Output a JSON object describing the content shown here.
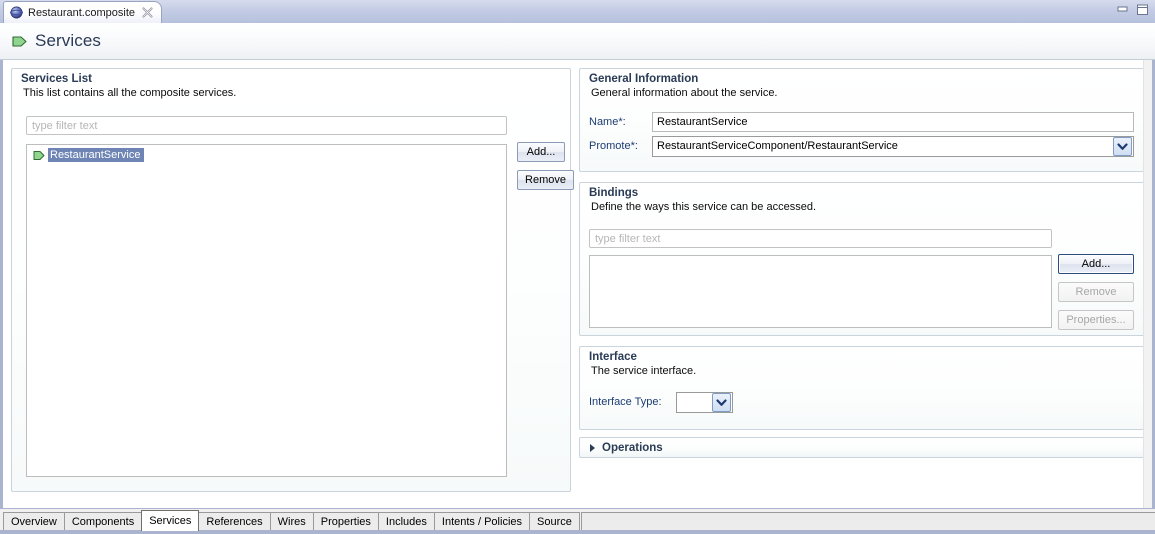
{
  "window": {
    "tab_title": "Restaurant.composite",
    "tab_icon": "sphere-icon",
    "close_icon": "close-icon",
    "minimize_icon": "minimize-icon",
    "maximize_icon": "maximize-icon"
  },
  "form_header": {
    "title": "Services",
    "icon": "service-arrow-icon"
  },
  "services_list": {
    "title": "Services List",
    "description": "This list contains all the composite services.",
    "filter_placeholder": "type filter text",
    "items": [
      {
        "label": "RestaurantService",
        "icon": "service-arrow-icon",
        "selected": true
      }
    ],
    "add_label": "Add...",
    "remove_label": "Remove"
  },
  "general_information": {
    "title": "General Information",
    "description": "General information about the service.",
    "name_label": "Name*:",
    "name_value": "RestaurantService",
    "promote_label": "Promote*:",
    "promote_value": "RestaurantServiceComponent/RestaurantService",
    "dropdown_icon": "chevron-down-icon"
  },
  "bindings": {
    "title": "Bindings",
    "description": "Define the ways this service can be accessed.",
    "filter_placeholder": "type filter text",
    "items": [],
    "add_label": "Add...",
    "remove_label": "Remove",
    "properties_label": "Properties..."
  },
  "interface": {
    "title": "Interface",
    "description": "The service interface.",
    "type_label": "Interface Type:",
    "type_value": "",
    "dropdown_icon": "chevron-down-icon"
  },
  "operations": {
    "title": "Operations",
    "expanded": false,
    "twistie_icon": "chevron-right-icon"
  },
  "bottom_tabs": {
    "active": "Services",
    "items": [
      {
        "label": "Overview"
      },
      {
        "label": "Components"
      },
      {
        "label": "Services"
      },
      {
        "label": "References"
      },
      {
        "label": "Wires"
      },
      {
        "label": "Properties"
      },
      {
        "label": "Includes"
      },
      {
        "label": "Intents / Policies"
      },
      {
        "label": "Source"
      }
    ]
  },
  "colors": {
    "selection": "#6d84b4",
    "section_title": "#2a3b55",
    "field_label": "#1d3c73",
    "frame": "#aab4cf",
    "service_icon_green": "#8fd48f"
  }
}
